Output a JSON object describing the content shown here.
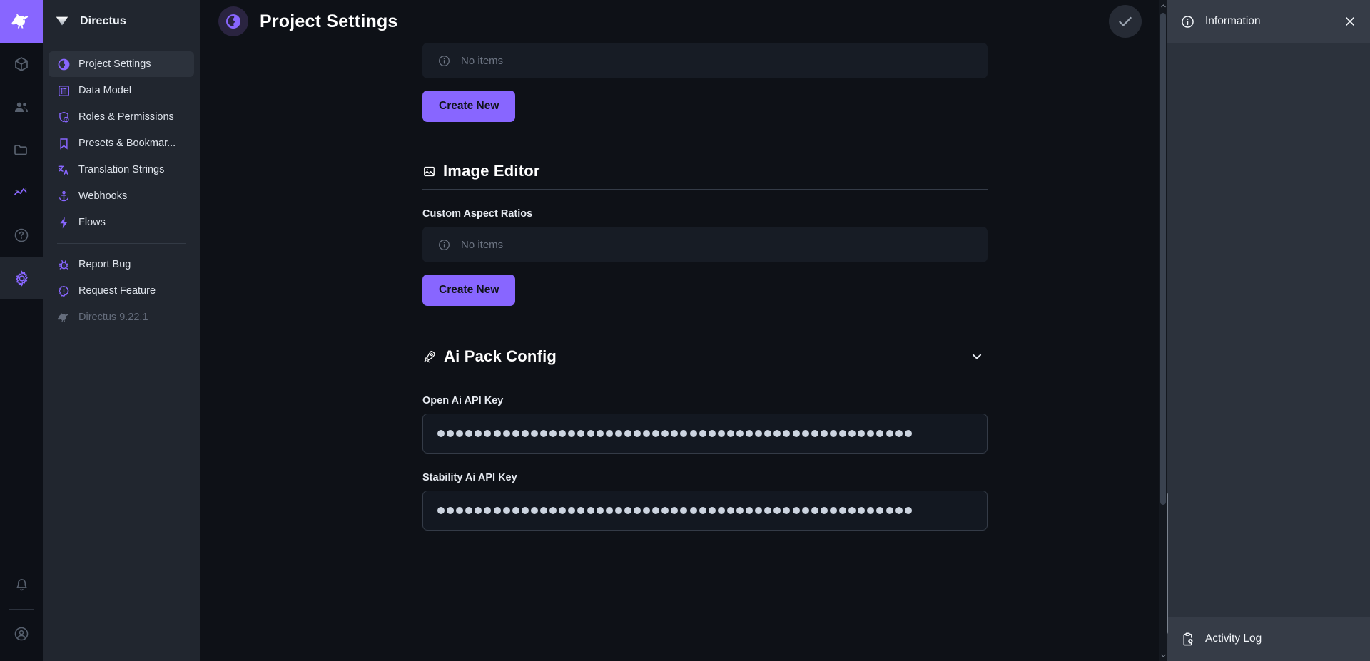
{
  "brand": {
    "accent": "#8866ff",
    "logo_icon": "directus-rabbit-logo",
    "project_name": "Directus"
  },
  "module_bar": {
    "items": [
      {
        "icon": "cube-icon",
        "name": "content",
        "active": false
      },
      {
        "icon": "users-icon",
        "name": "user-directory",
        "active": false
      },
      {
        "icon": "folder-icon",
        "name": "file-library",
        "active": false
      },
      {
        "icon": "insights-icon",
        "name": "insights",
        "active": false
      },
      {
        "icon": "help-circle-icon",
        "name": "help",
        "active": false
      },
      {
        "icon": "gear-icon",
        "name": "settings",
        "active": true
      }
    ],
    "bottom_items": [
      {
        "icon": "bell-icon",
        "name": "notifications"
      },
      {
        "icon": "account-circle-icon",
        "name": "user-menu"
      }
    ]
  },
  "sidebar": {
    "header_title": "Directus",
    "header_icon": "directus-mark-icon",
    "items": [
      {
        "label": "Project Settings",
        "icon": "globe-icon",
        "active": true
      },
      {
        "label": "Data Model",
        "icon": "list-box-icon",
        "active": false
      },
      {
        "label": "Roles & Permissions",
        "icon": "shield-account-icon",
        "active": false
      },
      {
        "label": "Presets & Bookmar...",
        "icon": "bookmark-icon",
        "active": false
      },
      {
        "label": "Translation Strings",
        "icon": "translate-icon",
        "active": false
      },
      {
        "label": "Webhooks",
        "icon": "anchor-icon",
        "active": false
      },
      {
        "label": "Flows",
        "icon": "bolt-icon",
        "active": false
      }
    ],
    "secondary_items": [
      {
        "label": "Report Bug",
        "icon": "bug-icon",
        "muted": false
      },
      {
        "label": "Request Feature",
        "icon": "alert-badge-icon",
        "muted": false
      },
      {
        "label": "Directus 9.22.1",
        "icon": "directus-rabbit-icon",
        "muted": true
      }
    ]
  },
  "header": {
    "title": "Project Settings",
    "avatar_icon": "globe-icon",
    "save_icon": "check-icon",
    "save_label": "Save"
  },
  "main": {
    "top_field": {
      "empty_text": "No items",
      "empty_icon": "info-circle-icon",
      "create_label": "Create New"
    },
    "image_editor": {
      "section_title": "Image Editor",
      "section_icon": "image-icon",
      "field_label": "Custom Aspect Ratios",
      "empty_text": "No items",
      "empty_icon": "info-circle-icon",
      "create_label": "Create New"
    },
    "ai_pack": {
      "section_title": "Ai Pack Config",
      "section_icon": "rocket-icon",
      "collapse_icon": "chevron-down-icon",
      "fields": [
        {
          "label": "Open Ai API Key",
          "masked": true,
          "mask_length": 51
        },
        {
          "label": "Stability Ai API Key",
          "masked": true,
          "mask_length": 51
        }
      ]
    }
  },
  "info_panel": {
    "title": "Information",
    "title_icon": "info-circle-icon",
    "close_icon": "close-icon",
    "footer_label": "Activity Log",
    "footer_icon": "clipboard-clock-icon"
  }
}
